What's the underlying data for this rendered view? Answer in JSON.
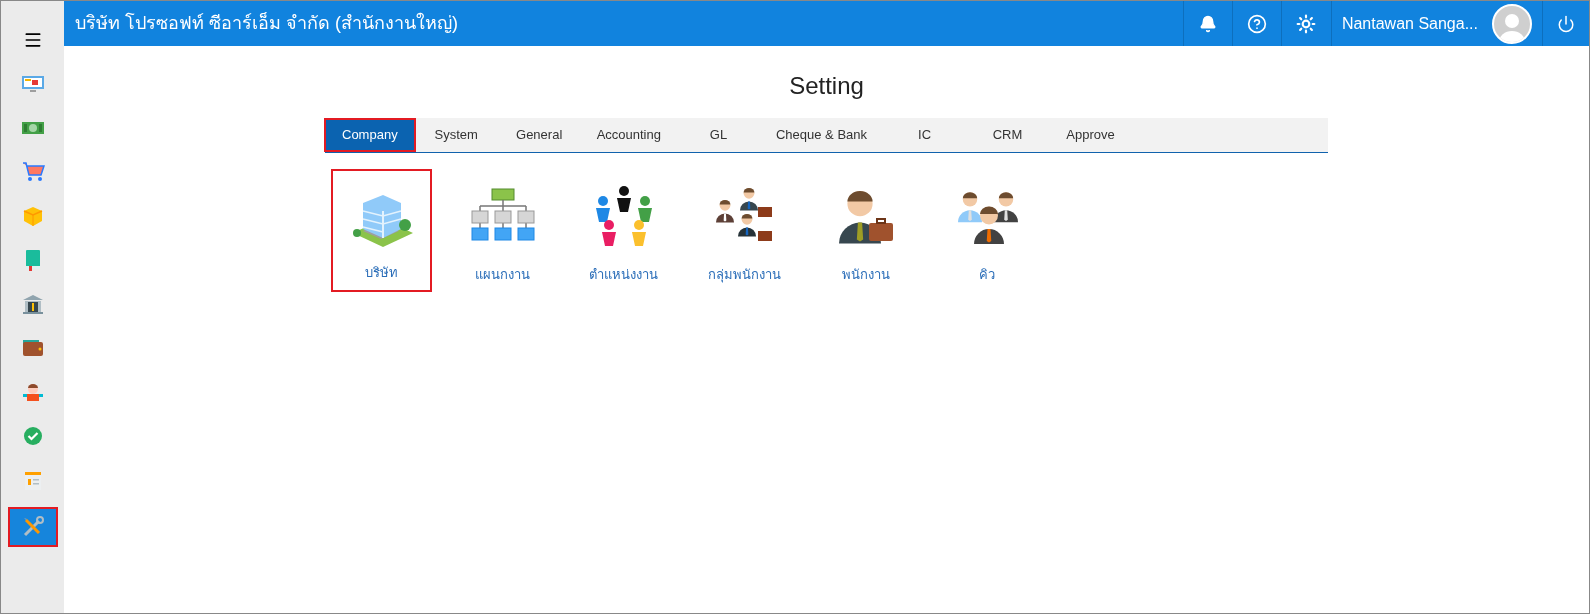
{
  "header": {
    "title": "บริษัท โปรซอฟท์ ซีอาร์เอ็ม จำกัด (สำนักงานใหญ่)",
    "user_name": "Nantawan Sanga..."
  },
  "sidebar": {
    "items": [
      {
        "selected": false
      },
      {
        "selected": false
      },
      {
        "selected": false
      },
      {
        "selected": false
      },
      {
        "selected": false
      },
      {
        "selected": false
      },
      {
        "selected": false
      },
      {
        "selected": false
      },
      {
        "selected": false
      },
      {
        "selected": false
      },
      {
        "selected": true
      }
    ]
  },
  "page": {
    "title": "Setting"
  },
  "tabs": [
    {
      "label": "Company",
      "selected": true
    },
    {
      "label": "System",
      "selected": false
    },
    {
      "label": "General",
      "selected": false
    },
    {
      "label": "Accounting",
      "selected": false
    },
    {
      "label": "GL",
      "selected": false
    },
    {
      "label": "Cheque & Bank",
      "selected": false
    },
    {
      "label": "IC",
      "selected": false
    },
    {
      "label": "CRM",
      "selected": false
    },
    {
      "label": "Approve",
      "selected": false
    }
  ],
  "tiles": [
    {
      "label": "บริษัท",
      "selected": true
    },
    {
      "label": "แผนกงาน",
      "selected": false
    },
    {
      "label": "ตำแหน่งงาน",
      "selected": false
    },
    {
      "label": "กลุ่มพนักงาน",
      "selected": false
    },
    {
      "label": "พนักงาน",
      "selected": false
    },
    {
      "label": "คิว",
      "selected": false
    }
  ]
}
